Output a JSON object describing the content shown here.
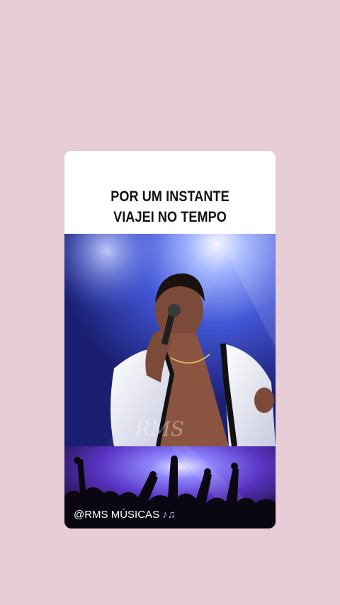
{
  "story": {
    "caption_line1": "POR UM INSTANTE",
    "caption_line2": "VIAJEI NO TEMPO",
    "handle": "@RMS MÚSICAS",
    "handle_icon": "music-notes-icon",
    "watermark": "RMS Músicas"
  },
  "colors": {
    "background": "#e7cdd6",
    "card": "#ffffff",
    "stage_blue": "#3b4fc7",
    "crowd_purple": "#6a3cc9"
  }
}
